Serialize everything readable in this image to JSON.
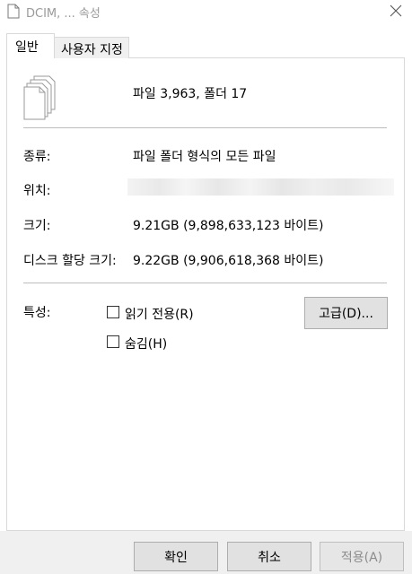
{
  "window": {
    "title": "DCIM, ... 속성"
  },
  "icons": {
    "title_icon": "document-icon",
    "close": "close-icon",
    "files": "multiple-files-icon"
  },
  "tabs": [
    {
      "label": "일반",
      "active": true
    },
    {
      "label": "사용자 지정",
      "active": false
    }
  ],
  "summary": "파일 3,963, 폴더 17",
  "fields": {
    "type_label": "종류:",
    "type_value": "파일 폴더 형식의 모든 파일",
    "location_label": "위치:",
    "size_label": "크기:",
    "size_value": "9.21GB (9,898,633,123 바이트)",
    "disk_size_label": "디스크 할당 크기:",
    "disk_size_value": "9.22GB (9,906,618,368 바이트)",
    "attributes_label": "특성:"
  },
  "attributes": {
    "readonly": {
      "label": "읽기 전용(R)",
      "checked": false
    },
    "hidden": {
      "label": "숨김(H)",
      "checked": false
    },
    "advanced_button": "고급(D)..."
  },
  "footer": {
    "ok": "확인",
    "cancel": "취소",
    "apply": "적용(A)",
    "apply_enabled": false
  }
}
